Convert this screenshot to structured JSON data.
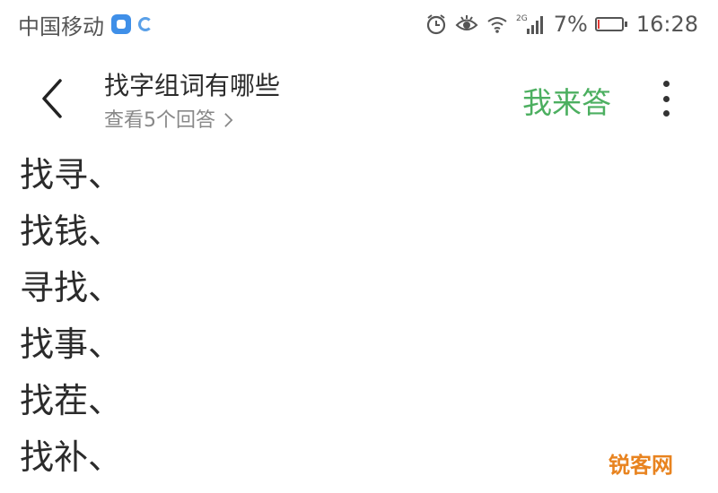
{
  "status_bar": {
    "carrier": "中国移动",
    "network_type": "2G",
    "battery_percent": "7%",
    "battery_level": 0.07,
    "time": "16:28",
    "icons": [
      "app-notification-icon",
      "sync-icon",
      "alarm-icon",
      "eye-protection-icon",
      "wifi-icon",
      "signal-icon",
      "battery-icon"
    ]
  },
  "header": {
    "title": "找字组词有哪些",
    "answers_link": "查看5个回答",
    "answer_button": "我来答",
    "back_icon": "chevron-left-icon",
    "more_icon": "more-vertical-icon"
  },
  "answer": {
    "lines": [
      "找寻、",
      "找钱、",
      "寻找、",
      "找事、",
      "找茬、",
      "找补、"
    ]
  },
  "watermark": "锐客网",
  "colors": {
    "accent_green": "#4caf60",
    "text": "#2b2b2b",
    "secondary_text": "#888888",
    "watermark": "#e8831f",
    "battery_low": "#e53935"
  }
}
